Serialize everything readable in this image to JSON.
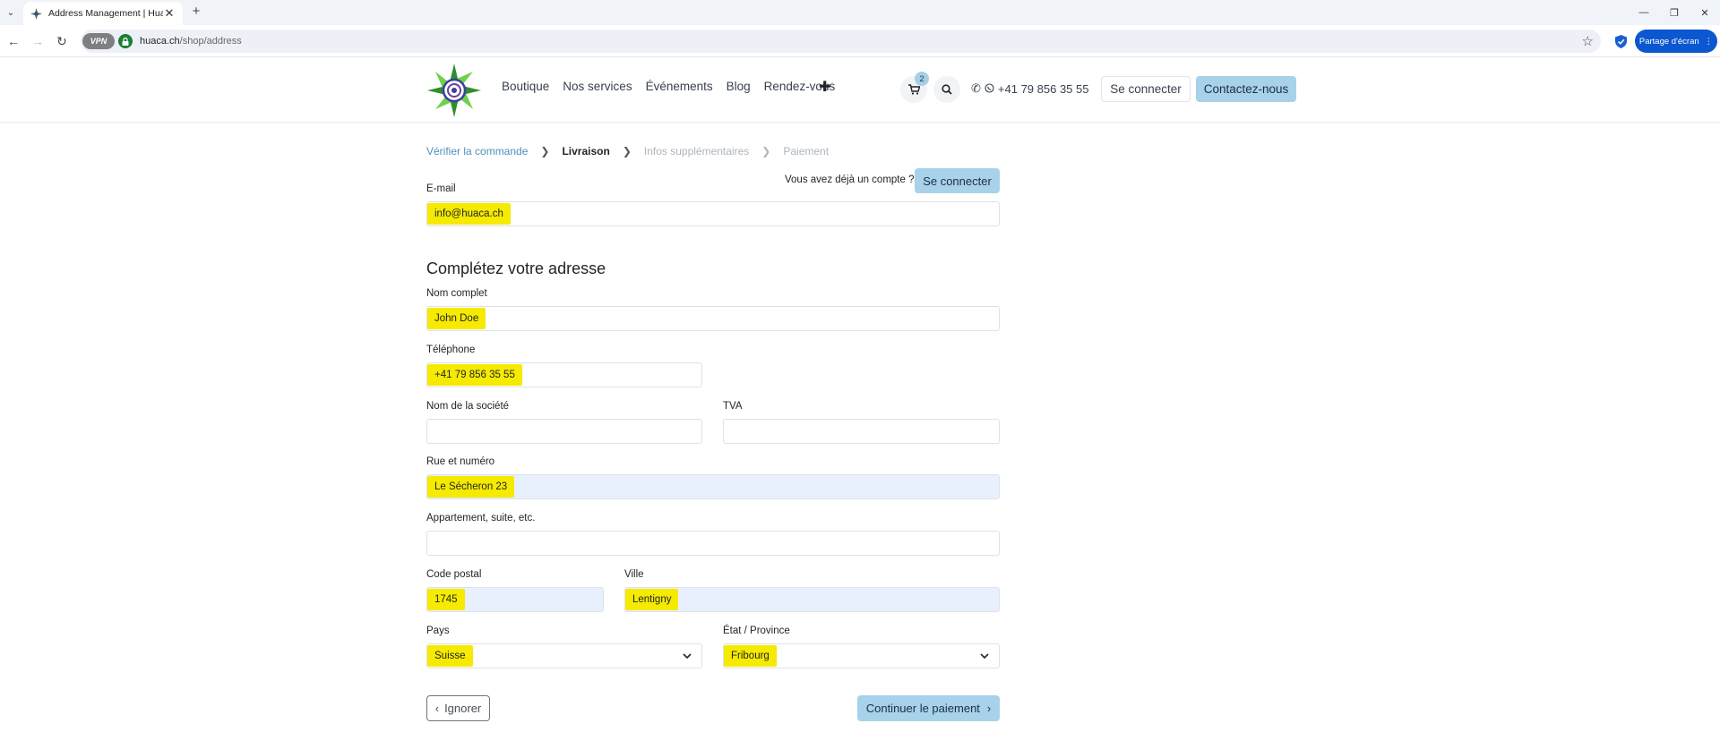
{
  "browser": {
    "tab_title": "Address Management | Huaca",
    "url_host": "huaca.ch",
    "url_path": "/shop/address",
    "vpn_label": "VPN",
    "share_label": "Partage d'écran"
  },
  "header": {
    "nav": [
      "Boutique",
      "Nos services",
      "Événements",
      "Blog",
      "Rendez-vous"
    ],
    "cart_count": "2",
    "phone": "+41 79 856 35 55",
    "login_label": "Se connecter",
    "contact_label": "Contactez-nous"
  },
  "checkout": {
    "steps": [
      {
        "label": "Vérifier la commande",
        "state": "done"
      },
      {
        "label": "Livraison",
        "state": "active"
      },
      {
        "label": "Infos supplémentaires",
        "state": "todo"
      },
      {
        "label": "Paiement",
        "state": "todo"
      }
    ],
    "already_account": "Vous avez déjà un compte ?",
    "already_login": "Se connecter",
    "email_label": "E-mail",
    "email_value": "info@huaca.ch",
    "section_title": "Complétez votre adresse",
    "name_label": "Nom complet",
    "name_value": "John Doe",
    "phone_label": "Téléphone",
    "phone_value": "+41 79 856 35 55",
    "company_label": "Nom de la société",
    "company_value": "",
    "vat_label": "TVA",
    "vat_value": "",
    "street_label": "Rue et numéro",
    "street_value": "Le Sécheron 23",
    "apt_label": "Appartement, suite, etc.",
    "apt_value": "",
    "zip_label": "Code postal",
    "zip_value": "1745",
    "city_label": "Ville",
    "city_value": "Lentigny",
    "country_label": "Pays",
    "country_value": "Suisse",
    "state_label": "État / Province",
    "state_value": "Fribourg",
    "ignore_label": "Ignorer",
    "continue_label": "Continuer le paiement"
  },
  "colors": {
    "accent": "#a8d1ea",
    "highlight": "#f5ea00",
    "autofill": "#e8f0fe",
    "link": "#4d8fbf"
  }
}
